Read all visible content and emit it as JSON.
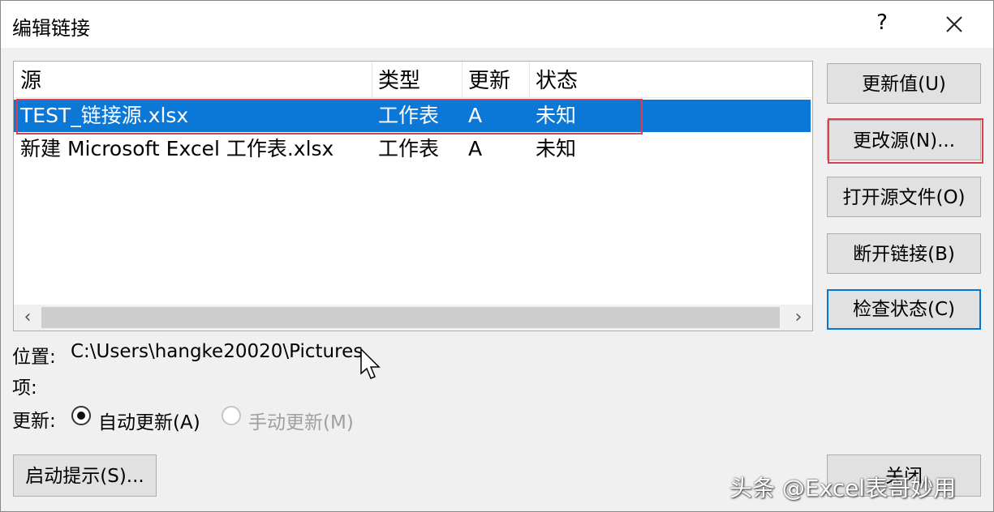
{
  "window": {
    "title": "编辑链接",
    "help": "?"
  },
  "list": {
    "columns": [
      "源",
      "类型",
      "更新",
      "状态"
    ],
    "rows": [
      {
        "source": "TEST_链接源.xlsx",
        "type": "工作表",
        "update": "A",
        "status": "未知",
        "selected": true
      },
      {
        "source": "新建 Microsoft Excel 工作表.xlsx",
        "type": "工作表",
        "update": "A",
        "status": "未知",
        "selected": false
      }
    ]
  },
  "buttons": {
    "update_values": "更新值(U)",
    "change_source": "更改源(N)...",
    "open_source": "打开源文件(O)",
    "break_link": "断开链接(B)",
    "check_status": "检查状态(C)",
    "startup_prompt": "启动提示(S)...",
    "close": "关闭"
  },
  "details": {
    "location_label": "位置:",
    "location_value": "C:\\Users\\hangke20020\\Pictures",
    "item_label": "项:",
    "update_label": "更新:",
    "auto_update": "自动更新(A)",
    "manual_update": "手动更新(M)",
    "auto_selected": true
  },
  "watermark": "头条 @Excel表哥妙用",
  "colors": {
    "selection": "#0b78d7",
    "highlight": "#d9414a",
    "focus": "#0078d7"
  }
}
